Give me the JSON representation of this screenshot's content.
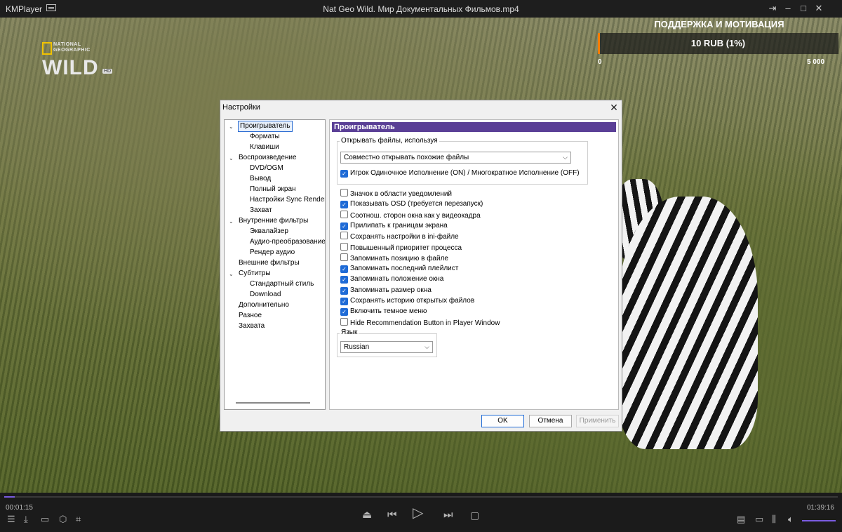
{
  "titlebar": {
    "app_name": "KMPlayer",
    "title": "Nat Geo Wild. Мир Документальных Фильмов.mp4",
    "pin_icon": "pin-icon",
    "minimize": "–",
    "maximize": "□",
    "close": "✕"
  },
  "logo": {
    "ng_line1": "NATIONAL",
    "ng_line2": "GEOGRAPHIC",
    "wild": "WILD",
    "hd": "HD"
  },
  "donation": {
    "title": "ПОДДЕРЖКА И МОТИВАЦИЯ",
    "amount": "10 RUB (1%)",
    "progress": 0.01,
    "min": "0",
    "max": "5 000",
    "accent": "#f57c00"
  },
  "controls": {
    "current_time": "00:01:15",
    "total_time": "01:39:16",
    "progress": 0.013,
    "accent": "#7a5ce0"
  },
  "dialog": {
    "title": "Настройки",
    "close": "✕",
    "tree": [
      {
        "label": "Проигрыватель",
        "level": 0,
        "expanded": true,
        "selected": true
      },
      {
        "label": "Форматы",
        "level": 1
      },
      {
        "label": "Клавиши",
        "level": 1
      },
      {
        "label": "Воспроизведение",
        "level": 0,
        "expanded": true
      },
      {
        "label": "DVD/OGM",
        "level": 1
      },
      {
        "label": "Вывод",
        "level": 1
      },
      {
        "label": "Полный экран",
        "level": 1
      },
      {
        "label": "Настройки Sync Render",
        "level": 1
      },
      {
        "label": "Захват",
        "level": 1
      },
      {
        "label": "Внутренние фильтры",
        "level": 0,
        "expanded": true
      },
      {
        "label": "Эквалайзер",
        "level": 1
      },
      {
        "label": "Аудио-преобразование",
        "level": 1
      },
      {
        "label": "Рендер аудио",
        "level": 1
      },
      {
        "label": "Внешние фильтры",
        "level": 0
      },
      {
        "label": "Субтитры",
        "level": 0,
        "expanded": true
      },
      {
        "label": "Стандартный стиль",
        "level": 1
      },
      {
        "label": "Download",
        "level": 1
      },
      {
        "label": "Дополнительно",
        "level": 0
      },
      {
        "label": "Разное",
        "level": 0
      },
      {
        "label": "Захвата",
        "level": 0
      }
    ],
    "panel": {
      "header": "Проигрыватель",
      "open_group_label": "Открывать файлы, используя",
      "open_mode_value": "Совместно открывать похожие файлы",
      "single_instance": {
        "label": "Игрок Одиночное Исполнение (ON) / Многократное Исполнение (OFF)",
        "checked": true
      },
      "options": [
        {
          "label": "Значок в области уведомлений",
          "checked": false
        },
        {
          "label": "Показывать OSD (требуется перезапуск)",
          "checked": true
        },
        {
          "label": "Соотнош. сторон окна как у видеокадра",
          "checked": false
        },
        {
          "label": "Прилипать к границам экрана",
          "checked": true
        },
        {
          "label": "Сохранять настройки в ini-файле",
          "checked": false
        },
        {
          "label": "Повышенный приоритет процесса",
          "checked": false
        },
        {
          "label": "Запоминать позицию в файле",
          "checked": false
        },
        {
          "label": "Запоминать последний плейлист",
          "checked": true
        },
        {
          "label": "Запоминать положение окна",
          "checked": true
        },
        {
          "label": "Запоминать размер окна",
          "checked": true
        },
        {
          "label": "Сохранять историю открытых файлов",
          "checked": true
        },
        {
          "label": "Включить темное меню",
          "checked": true
        },
        {
          "label": "Hide Recommendation Button in Player Window",
          "checked": false
        }
      ],
      "language_label": "Язык",
      "language_value": "Russian"
    },
    "buttons": {
      "ok": "OK",
      "cancel": "Отмена",
      "apply": "Применить"
    }
  }
}
